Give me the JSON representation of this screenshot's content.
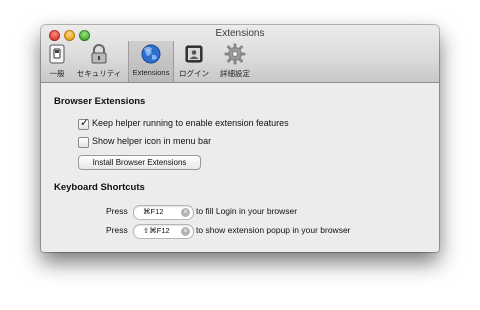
{
  "window": {
    "title": "Extensions"
  },
  "toolbar": {
    "items": [
      {
        "label": "一般",
        "icon": "switch-icon"
      },
      {
        "label": "セキュリティ",
        "icon": "lock-icon"
      },
      {
        "label": "Extensions",
        "icon": "globe-icon",
        "selected": true
      },
      {
        "label": "ログイン",
        "icon": "login-icon"
      },
      {
        "label": "詳細設定",
        "icon": "gear-icon"
      }
    ]
  },
  "browser_extensions": {
    "title": "Browser Extensions",
    "keep_helper": {
      "label": "Keep helper running to enable extension features",
      "checked": true
    },
    "show_icon": {
      "label": "Show helper icon in menu bar",
      "checked": false
    },
    "install_button": "Install Browser Extensions"
  },
  "keyboard_shortcuts": {
    "title": "Keyboard Shortcuts",
    "rows": [
      {
        "press": "Press",
        "shortcut": "⌘F12",
        "description": "to fill Login in your browser"
      },
      {
        "press": "Press",
        "shortcut": "⇧⌘F12",
        "description": "to show extension popup in your browser"
      }
    ]
  }
}
